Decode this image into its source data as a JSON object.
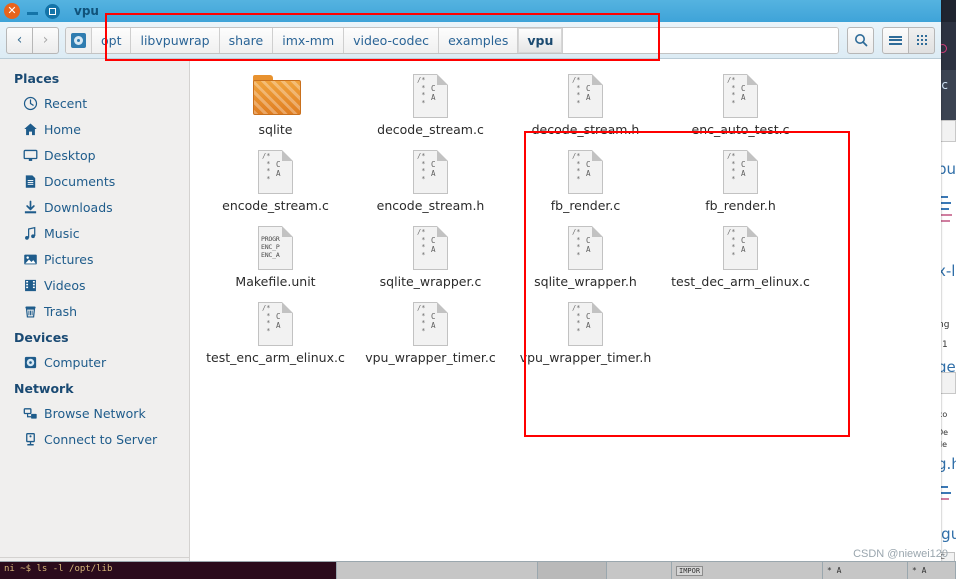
{
  "window": {
    "title": "vpu",
    "controls": {
      "close": "✕",
      "minimize": "",
      "maximize": ""
    }
  },
  "toolbar": {
    "back_label": "‹",
    "forward_label": "›",
    "search_label": "",
    "list_view_label": "",
    "grid_view_label": "",
    "breadcrumbs": [
      {
        "label": "opt",
        "active": false
      },
      {
        "label": "libvpuwrap",
        "active": false
      },
      {
        "label": "share",
        "active": false
      },
      {
        "label": "imx-mm",
        "active": false
      },
      {
        "label": "video-codec",
        "active": false
      },
      {
        "label": "examples",
        "active": false
      },
      {
        "label": "vpu",
        "active": true
      }
    ]
  },
  "sidebar": {
    "sections": [
      {
        "title": "Places",
        "items": [
          {
            "label": "Recent",
            "icon": "clock-icon"
          },
          {
            "label": "Home",
            "icon": "home-icon"
          },
          {
            "label": "Desktop",
            "icon": "monitor-icon"
          },
          {
            "label": "Documents",
            "icon": "document-icon"
          },
          {
            "label": "Downloads",
            "icon": "download-icon"
          },
          {
            "label": "Music",
            "icon": "music-note-icon"
          },
          {
            "label": "Pictures",
            "icon": "picture-icon"
          },
          {
            "label": "Videos",
            "icon": "film-icon"
          },
          {
            "label": "Trash",
            "icon": "trash-icon"
          }
        ]
      },
      {
        "title": "Devices",
        "items": [
          {
            "label": "Computer",
            "icon": "drive-icon"
          }
        ]
      },
      {
        "title": "Network",
        "items": [
          {
            "label": "Browse Network",
            "icon": "network-icon"
          },
          {
            "label": "Connect to Server",
            "icon": "server-icon"
          }
        ]
      }
    ]
  },
  "files": [
    {
      "name": "sqlite",
      "type": "folder"
    },
    {
      "name": "decode_stream.c",
      "type": "c-source"
    },
    {
      "name": "decode_stream.h",
      "type": "c-source"
    },
    {
      "name": "enc_auto_test.c",
      "type": "c-source"
    },
    {
      "name": "",
      "type": "empty"
    },
    {
      "name": "encode_stream.c",
      "type": "c-source"
    },
    {
      "name": "encode_stream.h",
      "type": "c-source"
    },
    {
      "name": "fb_render.c",
      "type": "c-source"
    },
    {
      "name": "fb_render.h",
      "type": "c-source"
    },
    {
      "name": "",
      "type": "empty"
    },
    {
      "name": "Makefile.unit",
      "type": "makefile"
    },
    {
      "name": "sqlite_wrapper.c",
      "type": "c-source"
    },
    {
      "name": "sqlite_wrapper.h",
      "type": "c-source"
    },
    {
      "name": "test_dec_arm_elinux.c",
      "type": "c-source"
    },
    {
      "name": "",
      "type": "empty"
    },
    {
      "name": "test_enc_arm_elinux.c",
      "type": "c-source"
    },
    {
      "name": "vpu_wrapper_timer.c",
      "type": "c-source"
    },
    {
      "name": "vpu_wrapper_timer.h",
      "type": "c-source"
    },
    {
      "name": "",
      "type": "empty"
    },
    {
      "name": "",
      "type": "empty"
    }
  ],
  "icon_glyphs": {
    "c_source_comment": "/*\n *\n *\n *",
    "c_source_letters": "C\nA",
    "makefile_lines": "PROGR\nENC_P\nENC_A"
  },
  "annotations": [
    {
      "name": "path-highlight",
      "color": "#ff0000"
    },
    {
      "name": "files-highlight",
      "color": "#ff0000"
    }
  ],
  "taskbar": {
    "terminal_text": "ni     ~$ ls -l /opt/lib",
    "cells": [
      "",
      "",
      "",
      "IMPOR",
      "* A",
      "* A"
    ]
  },
  "watermark": "CSDN @niewei120",
  "background_window": {
    "heading1": "pu",
    "heading2": "x-l",
    "heading3": "ge",
    "heading4": "g.h",
    "heading5": "igu",
    "small1": "ng",
    "small2": "1",
    "small3": "co",
    "small4": "De",
    "small5": "de",
    "tab_label": "-c",
    "top_label": "pu"
  },
  "colors": {
    "titlebar": "#3ea3d8",
    "close_button": "#e8641c",
    "accent_blue": "#2a6496",
    "annotation_red": "#ff0000",
    "folder_orange": "#e8922f"
  }
}
